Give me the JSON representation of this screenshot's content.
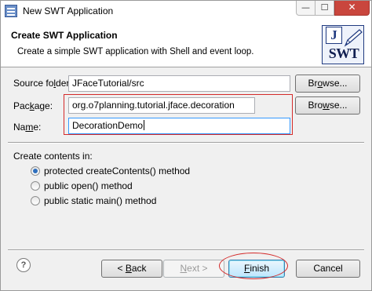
{
  "window": {
    "title": "New SWT Application",
    "controls": {
      "minimize": "—",
      "maximize": "☐",
      "close": "✕"
    }
  },
  "header": {
    "title": "Create SWT Application",
    "description": "Create a simple SWT application with Shell and event loop.",
    "logo": {
      "letter": "J",
      "text": "SWT",
      "icon": "swt-logo-icon"
    }
  },
  "form": {
    "source_folder": {
      "label_pre": "Source fo",
      "label_mn": "l",
      "label_post": "der:",
      "value": "JFaceTutorial/src",
      "browse_pre": "Br",
      "browse_mn": "o",
      "browse_post": "wse..."
    },
    "package": {
      "label_pre": "Pac",
      "label_mn": "k",
      "label_post": "age:",
      "value": "org.o7planning.tutorial.jface.decoration",
      "browse_pre": "Bro",
      "browse_mn": "w",
      "browse_post": "se..."
    },
    "name": {
      "label_pre": "Na",
      "label_mn": "m",
      "label_post": "e:",
      "value": "DecorationDemo"
    }
  },
  "create_contents": {
    "label": "Create contents in:",
    "options": [
      {
        "label": "protected createContents() method",
        "checked": true
      },
      {
        "label": "public open() method",
        "checked": false
      },
      {
        "label": "public static main() method",
        "checked": false
      }
    ]
  },
  "footer": {
    "help_icon": "help-icon",
    "help_glyph": "?",
    "back": {
      "pre": "< ",
      "mn": "B",
      "post": "ack"
    },
    "next": {
      "mn": "N",
      "post": "ext >"
    },
    "finish": {
      "mn": "F",
      "post": "inish"
    },
    "cancel": "Cancel"
  },
  "colors": {
    "annotation": "#d42a2a",
    "title_bar_close": "#c9463d",
    "focus_border": "#3399ff"
  }
}
